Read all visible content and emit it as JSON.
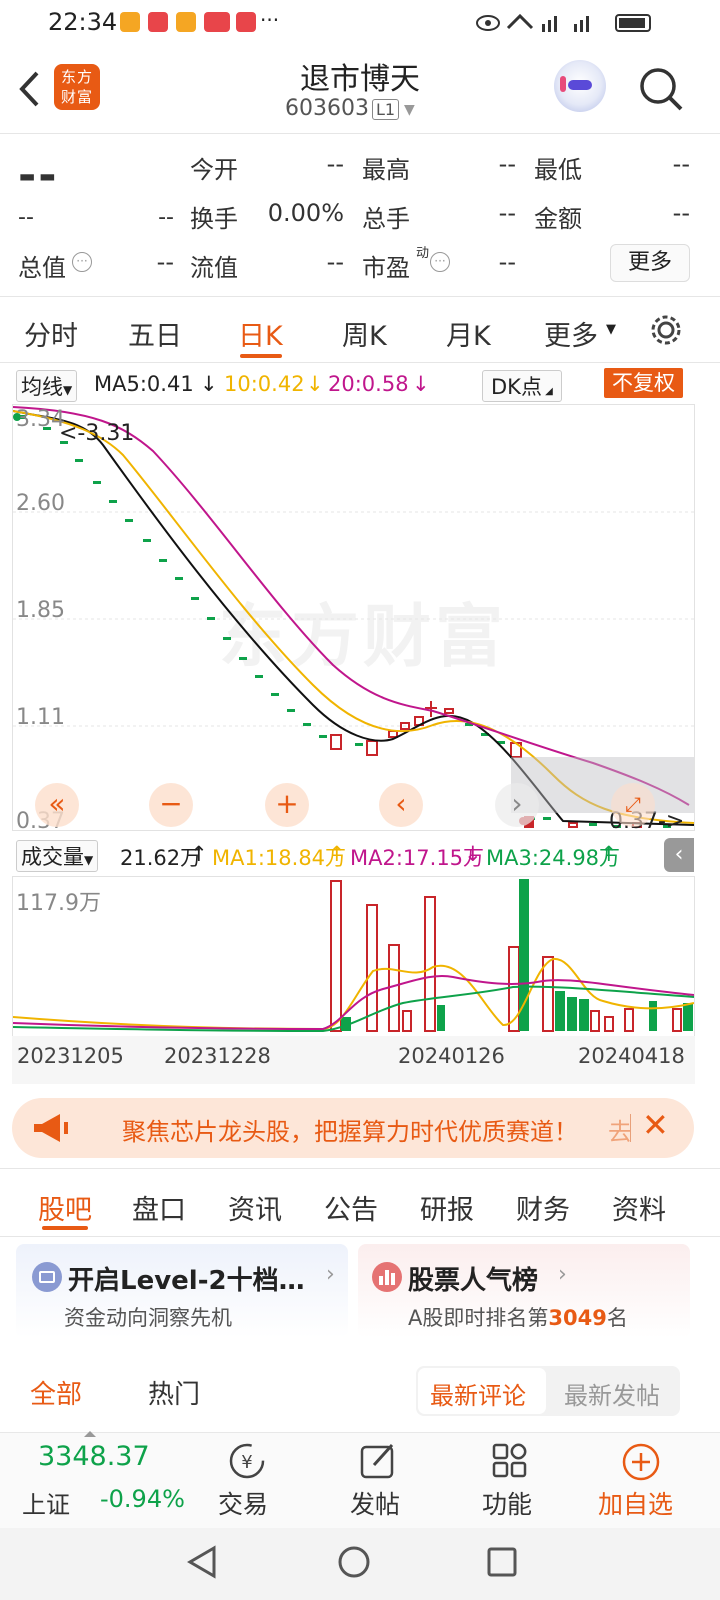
{
  "status": {
    "time": "22:34",
    "dots": "···"
  },
  "header": {
    "brand": "东方财富",
    "title": "退市博天",
    "code": "603603",
    "level": "L1"
  },
  "quote": {
    "price": "--",
    "change": "--",
    "change_pct": "--",
    "open_label": "今开",
    "open_val": "--",
    "high_label": "最高",
    "high_val": "--",
    "low_label": "最低",
    "low_val": "--",
    "turnover_label": "换手",
    "turnover_val": "0.00%",
    "vol_label": "总手",
    "vol_val": "--",
    "amount_label": "金额",
    "amount_val": "--",
    "mcap_label": "总值",
    "mcap_val": "--",
    "float_label": "流值",
    "float_val": "--",
    "pe_label": "市盈",
    "pe_sup": "动",
    "pe_val": "--",
    "more_button": "更多"
  },
  "tabs": [
    "分时",
    "五日",
    "日K",
    "周K",
    "月K",
    "更多"
  ],
  "kline": {
    "ma_select": "均线",
    "ma5": "MA5:0.41",
    "ma10": "10:0.42",
    "ma20": "20:0.58",
    "dk": "DK点",
    "adjust": "不复权",
    "y_ticks": [
      "3.34",
      "2.60",
      "1.85",
      "1.11",
      "0.37"
    ],
    "high_note": "<-3.31",
    "low_note": "0.37->",
    "watermark": "东方财富"
  },
  "volume": {
    "select": "成交量",
    "vol": "21.62万",
    "ma1": "MA1:18.84万",
    "ma2": "MA2:17.15万",
    "ma3": "MA3:24.98万",
    "max_label": "117.9万",
    "dates": [
      "20231205",
      "20231228",
      "20240126",
      "20240418"
    ]
  },
  "banner": {
    "text": "聚焦芯片龙头股，把握算力时代优质赛道！",
    "tail": "去"
  },
  "tabs2": [
    "股吧",
    "盘口",
    "资讯",
    "公告",
    "研报",
    "财务",
    "资料"
  ],
  "cards": {
    "left_title": "开启Level-2十档…",
    "left_sub": "资金动向洞察先机",
    "right_title": "股票人气榜",
    "right_sub_pre": "A股即时排名第",
    "right_rank": "3049",
    "right_sub_post": "名"
  },
  "filters": {
    "all": "全部",
    "hot": "热门",
    "latest_comment": "最新评论",
    "latest_post": "最新发帖"
  },
  "bottom": {
    "index_value": "3348.37",
    "index_name": "上证",
    "index_change": "-0.94%",
    "trade": "交易",
    "post": "发帖",
    "func": "功能",
    "add": "加自选"
  },
  "colors": {
    "accent": "#e85a14",
    "up": "#c8252a",
    "down": "#0ea24a",
    "ma10": "#f0b400",
    "ma20": "#c0168c"
  }
}
